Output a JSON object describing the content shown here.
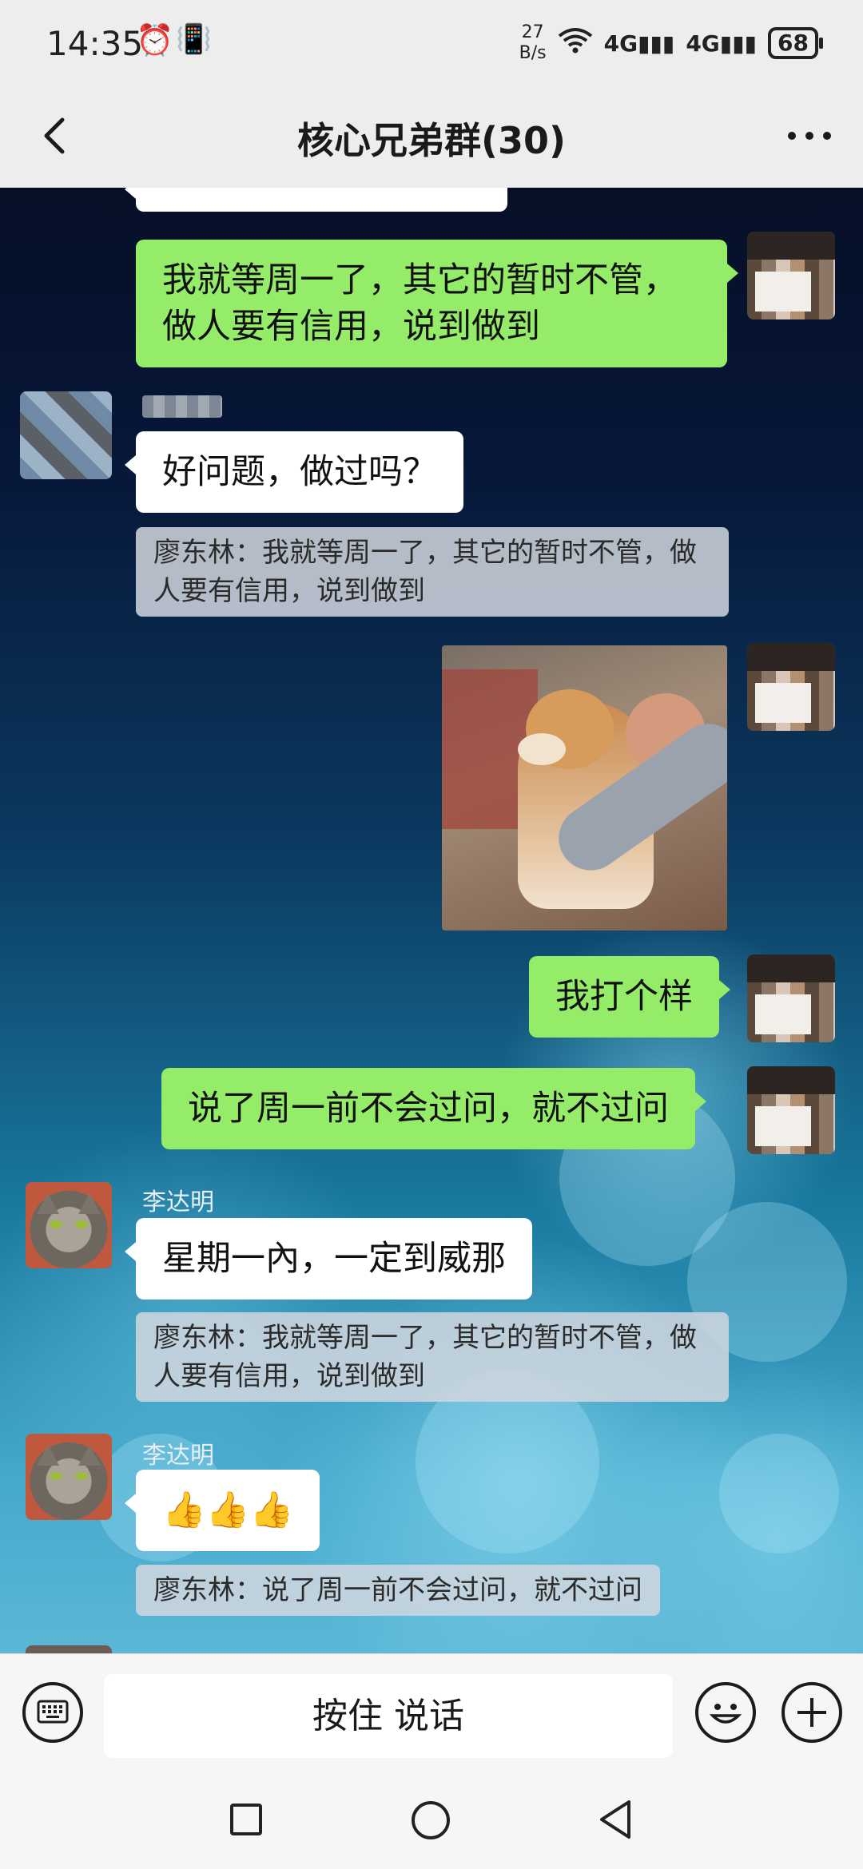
{
  "status_bar": {
    "time": "14:35",
    "net_speed_value": "27",
    "net_speed_unit": "B/s",
    "signal1": "4G",
    "signal2": "4G",
    "battery": "68"
  },
  "header": {
    "title": "核心兄弟群(30)"
  },
  "messages": [
    {
      "id": "m1",
      "side": "right",
      "type": "text",
      "text": "我就等周一了，其它的暂时不管，做人要有信用，说到做到"
    },
    {
      "id": "m2",
      "side": "left",
      "type": "text",
      "text": "好问题，做过吗？",
      "quote": "廖东林：我就等周一了，其它的暂时不管，做人要有信用，说到做到"
    },
    {
      "id": "m3",
      "side": "right",
      "type": "image",
      "image_desc": "shiba-dog-photo"
    },
    {
      "id": "m4",
      "side": "right",
      "type": "text",
      "text": "我打个样"
    },
    {
      "id": "m5",
      "side": "right",
      "type": "text",
      "text": "说了周一前不会过问，就不过问"
    },
    {
      "id": "m6",
      "side": "left",
      "sender": "李达明",
      "type": "text",
      "text": "星期一內，一定到威那",
      "quote": "廖东林：我就等周一了，其它的暂时不管，做人要有信用，说到做到"
    },
    {
      "id": "m7",
      "side": "left",
      "sender": "李达明",
      "type": "text",
      "text": "👍👍👍",
      "quote": "廖东林：说了周一前不会过问，就不过问"
    }
  ],
  "input_bar": {
    "hold_to_talk": "按住 说话",
    "left_icon": "keyboard-icon",
    "emoji_icon": "smile-icon",
    "plus_icon": "plus-icon"
  },
  "nav_bar": {
    "icons": [
      "recents-square-icon",
      "home-circle-icon",
      "back-triangle-icon"
    ]
  }
}
